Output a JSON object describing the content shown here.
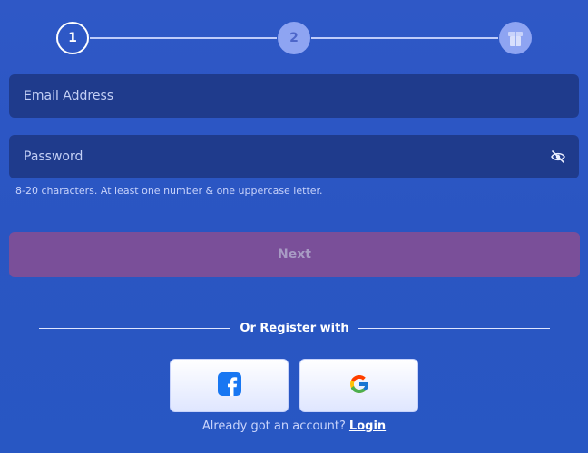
{
  "stepper": {
    "steps": [
      {
        "label": "1",
        "state": "active"
      },
      {
        "label": "2",
        "state": "inactive"
      },
      {
        "icon": "gift-icon",
        "state": "inactive"
      }
    ]
  },
  "form": {
    "email_placeholder": "Email Address",
    "email_value": "",
    "password_placeholder": "Password",
    "password_value": "",
    "password_hint": "8-20 characters. At least one number & one uppercase letter.",
    "visibility_icon": "eye-off-icon",
    "next_label": "Next"
  },
  "social": {
    "divider_label": "Or Register with",
    "providers": [
      {
        "name": "facebook",
        "icon": "facebook-icon"
      },
      {
        "name": "google",
        "icon": "google-icon"
      }
    ]
  },
  "footer": {
    "prompt": "Already got an account?",
    "login_label": "Login"
  },
  "colors": {
    "background": "#2a55c2",
    "input_bg": "#1f3b8c",
    "next_button": "#7a4f99",
    "step_inactive": "#8ea4f2",
    "facebook_blue": "#1877f2"
  }
}
